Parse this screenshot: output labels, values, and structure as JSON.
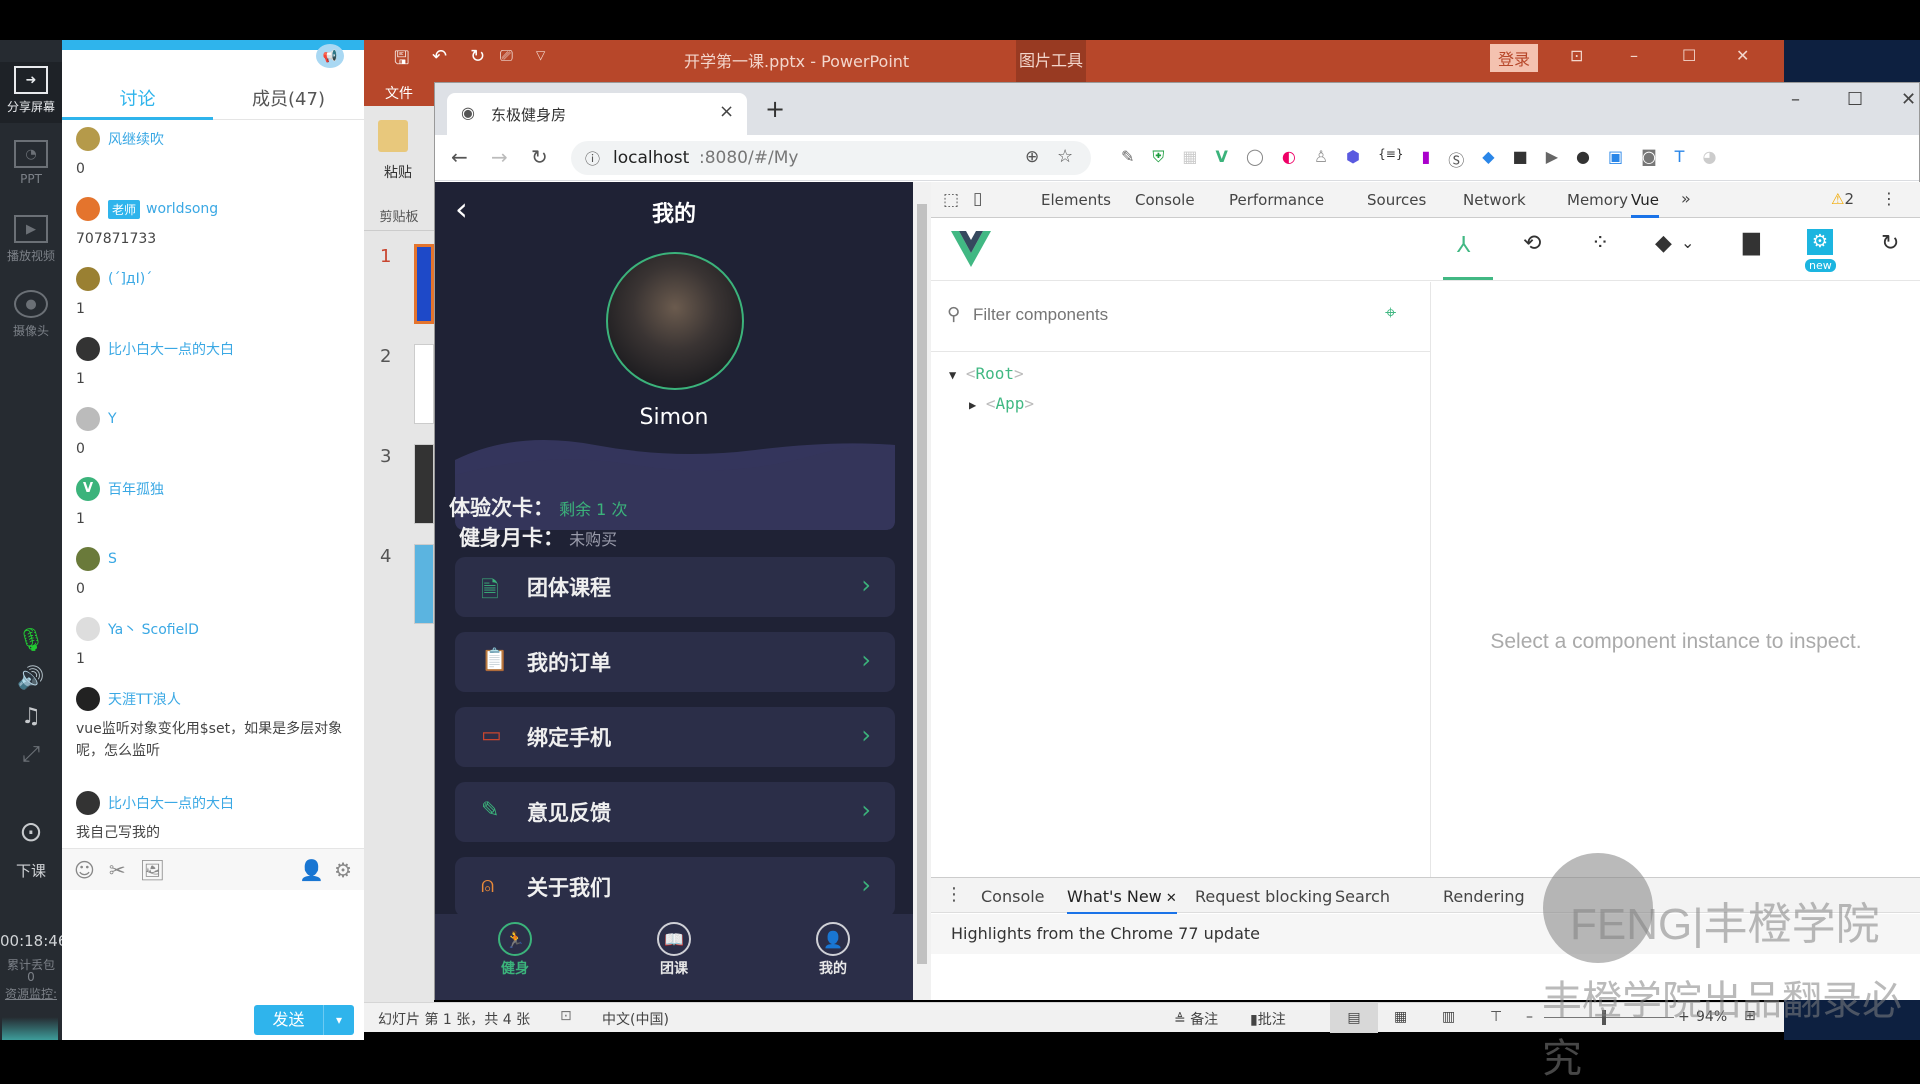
{
  "classroom": {
    "left_sidebar": {
      "items": [
        {
          "label": "分享屏幕",
          "icon": "share-screen-icon",
          "active": true
        },
        {
          "label": "PPT",
          "icon": "ppt-icon"
        },
        {
          "label": "播放视频",
          "icon": "play-video-icon"
        },
        {
          "label": "摄像头",
          "icon": "camera-icon"
        }
      ],
      "controls": [
        "microphone-icon",
        "speaker-icon",
        "music-icon",
        "fullscreen-icon"
      ],
      "end_class_label": "下课",
      "timer": "00:18:46",
      "packet_loss_label": "累计丢包",
      "packet_loss_value": "0",
      "resource_monitor_label": "资源监控:"
    },
    "chat": {
      "tabs": [
        {
          "label": "讨论",
          "active": true
        },
        {
          "label": "成员(47)",
          "active": false
        }
      ],
      "messages": [
        {
          "user": "风继续吹",
          "text": "0"
        },
        {
          "user": "worldsong",
          "badge": "老师",
          "text": "707871733"
        },
        {
          "user": "(´]дI)´",
          "text": "1"
        },
        {
          "user": "比小白大一点的大白",
          "text": "1"
        },
        {
          "user": "Y",
          "text": "0"
        },
        {
          "user": "百年孤独",
          "avatar_letter": "V",
          "text": "1"
        },
        {
          "user": "S",
          "text": "0"
        },
        {
          "user": "Ya丶 ScofielD",
          "text": "1"
        },
        {
          "user": "天涯TT浪人",
          "text": "vue监听对象变化用$set，如果是多层对象呢，怎么监听"
        },
        {
          "user": "比小白大一点的大白",
          "text": "我自己写我的"
        }
      ],
      "toolbar_icons": [
        "emoji-icon",
        "scissors-icon",
        "image-icon",
        "user-manage-icon",
        "settings-icon"
      ],
      "send_label": "发送",
      "send_dropdown": "▾"
    }
  },
  "powerpoint": {
    "title": "开学第一课.pptx - PowerPoint",
    "context_tab": "图片工具",
    "login_label": "登录",
    "file_tab": "文件",
    "paste_label": "粘贴",
    "clipboard_label": "剪贴板",
    "slides": [
      "1",
      "2",
      "3",
      "4"
    ],
    "status": {
      "slide_info": "幻灯片 第 1 张，共 4 张",
      "language": "中文(中国)",
      "notes_label": "备注",
      "comments_label": "批注",
      "zoom": "94%"
    }
  },
  "browser": {
    "tab_title": "东极健身房",
    "url_host": "localhost",
    "url_rest": ":8080/#/My",
    "new_tab": "+",
    "close_tab": "×"
  },
  "app": {
    "header_title": "我的",
    "back": "‹",
    "username": "Simon",
    "cards": [
      {
        "label": "体验次卡：",
        "value": "剩余 1 次",
        "value_color": "#3bb37b"
      },
      {
        "label": "健身月卡：",
        "value": "未购买",
        "value_color": "#9a9cab"
      }
    ],
    "menu": [
      {
        "label": "团体课程",
        "icon": "document-icon",
        "color": "#3bb37b"
      },
      {
        "label": "我的订单",
        "icon": "clipboard-icon",
        "color": "#e9b949"
      },
      {
        "label": "绑定手机",
        "icon": "tablet-icon",
        "color": "#c8452f"
      },
      {
        "label": "意见反馈",
        "icon": "pencil-icon",
        "color": "#3bb37b"
      },
      {
        "label": "关于我们",
        "icon": "user-icon",
        "color": "#e98a3a"
      }
    ],
    "tabbar": [
      {
        "label": "健身",
        "icon": "runner-icon",
        "active": true
      },
      {
        "label": "团课",
        "icon": "book-icon",
        "active": false
      },
      {
        "label": "我的",
        "icon": "profile-icon",
        "active": false
      }
    ]
  },
  "devtools": {
    "tabs": [
      "Elements",
      "Console",
      "Performance",
      "Sources",
      "Network",
      "Memory",
      "Vue"
    ],
    "active_tab": "Vue",
    "more": "»",
    "warnings": "2",
    "vue": {
      "new_badge": "new",
      "filter_placeholder": "Filter components",
      "tree": [
        {
          "name": "Root",
          "expanded": true
        },
        {
          "name": "App",
          "expanded": false
        }
      ],
      "empty_message": "Select a component instance to inspect."
    },
    "drawer": {
      "tabs": [
        "Console",
        "What's New",
        "Request blocking",
        "Search",
        "Rendering"
      ],
      "active_tab": "What's New",
      "headline": "Highlights from the Chrome 77 update"
    }
  },
  "watermark": {
    "logo": "FENG|丰橙学院",
    "caption": "丰橙学院出品翻录必究"
  }
}
